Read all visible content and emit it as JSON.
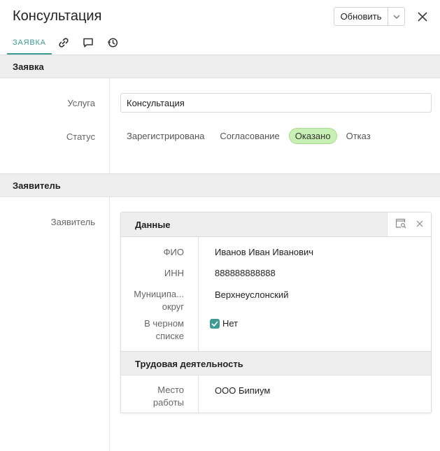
{
  "header": {
    "title": "Консультация",
    "update_button": "Обновить"
  },
  "tabs": [
    {
      "label": "ЗАЯВКА",
      "active": true
    },
    {
      "icon": "link-icon"
    },
    {
      "icon": "comment-icon"
    },
    {
      "icon": "history-icon"
    }
  ],
  "section_request": {
    "title": "Заявка",
    "service_label": "Услуга",
    "service_value": "Консультация",
    "status_label": "Статус",
    "status_options": [
      "Зарегистрирована",
      "Согласование",
      "Оказано",
      "Отказ"
    ],
    "status_selected": "Оказано"
  },
  "section_applicant": {
    "title": "Заявитель",
    "applicant_label": "Заявитель",
    "card": {
      "title": "Данные",
      "fields": {
        "fio_label": "ФИО",
        "fio_value": "Иванов Иван Иванович",
        "inn_label": "ИНН",
        "inn_value": "888888888888",
        "municipal_label_1": "Муниципа...",
        "municipal_label_2": "округ",
        "municipal_value": "Верхнеуслонский",
        "blacklist_label_1": "В черном",
        "blacklist_label_2": "списке",
        "blacklist_value": "Нет",
        "blacklist_checked": true
      },
      "work_title": "Трудовая деятельность",
      "work": {
        "workplace_label_1": "Место",
        "workplace_label_2": "работы",
        "workplace_value": "ООО Бипиум"
      }
    }
  },
  "colors": {
    "accent": "#3f9b94",
    "status_selected_bg": "#c9f0b4",
    "section_bg": "#eeeeee"
  }
}
